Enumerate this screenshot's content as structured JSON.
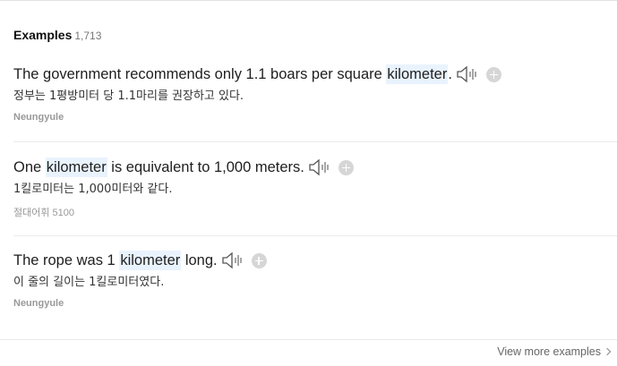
{
  "header": {
    "title": "Examples",
    "count": "1,713"
  },
  "examples": [
    {
      "before": "The government recommends only 1.1 boars per square ",
      "keyword": "kilometer",
      "after": ".",
      "translation": "정부는 1평방미터 당 1.1마리를 권장하고 있다.",
      "source": "Neungyule"
    },
    {
      "before": "One ",
      "keyword": "kilometer",
      "after": " is equivalent to 1,000 meters.",
      "translation": "1킬로미터는 1,000미터와 같다.",
      "source": "절대어휘 5100"
    },
    {
      "before": "The rope was 1 ",
      "keyword": "kilometer",
      "after": " long.",
      "translation": "이 줄의 길이는 1킬로미터였다.",
      "source": "Neungyule"
    }
  ],
  "icons": {
    "audio": "speaker-icon",
    "add": "plus-circle-icon"
  },
  "footer": {
    "more_label": "View more examples"
  }
}
